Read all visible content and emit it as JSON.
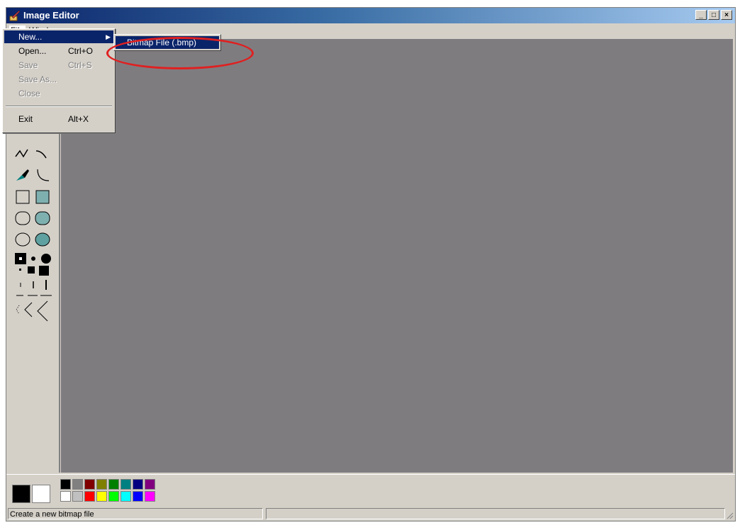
{
  "window": {
    "title": "Image Editor",
    "controls": {
      "minimize": "_",
      "maximize": "□",
      "close": "×"
    }
  },
  "menubar": {
    "items": [
      {
        "label": "File",
        "active": true
      },
      {
        "label": "Window",
        "active": false
      }
    ]
  },
  "file_menu": {
    "items": [
      {
        "label": "New...",
        "shortcut": "",
        "state": "highlighted",
        "has_submenu": true
      },
      {
        "label": "Open...",
        "shortcut": "Ctrl+O",
        "state": "enabled"
      },
      {
        "label": "Save",
        "shortcut": "Ctrl+S",
        "state": "disabled"
      },
      {
        "label": "Save As...",
        "shortcut": "",
        "state": "disabled"
      },
      {
        "label": "Close",
        "shortcut": "",
        "state": "disabled"
      },
      {
        "label": "Exit",
        "shortcut": "Alt+X",
        "state": "enabled"
      }
    ]
  },
  "new_submenu": {
    "items": [
      {
        "label": "Bitmap File (.bmp)",
        "state": "highlighted"
      }
    ]
  },
  "annotation": {
    "color": "#e02020",
    "shape": "oval"
  },
  "tools": [
    "polyline-tool",
    "curve-tool",
    "eyedropper-tool",
    "arc-tool",
    "rectangle-tool",
    "filled-rectangle-tool",
    "rounded-rectangle-tool",
    "filled-rounded-rectangle-tool",
    "ellipse-tool",
    "filled-ellipse-tool"
  ],
  "palette": {
    "foreground": "#000000",
    "background": "#ffffff",
    "top_row": [
      "#000000",
      "#808080",
      "#800000",
      "#808000",
      "#008000",
      "#008080",
      "#000080",
      "#800080"
    ],
    "bottom_row": [
      "#ffffff",
      "#c0c0c0",
      "#ff0000",
      "#ffff00",
      "#00ff00",
      "#00ffff",
      "#0000ff",
      "#ff00ff"
    ]
  },
  "statusbar": {
    "text": "Create a new bitmap file"
  }
}
